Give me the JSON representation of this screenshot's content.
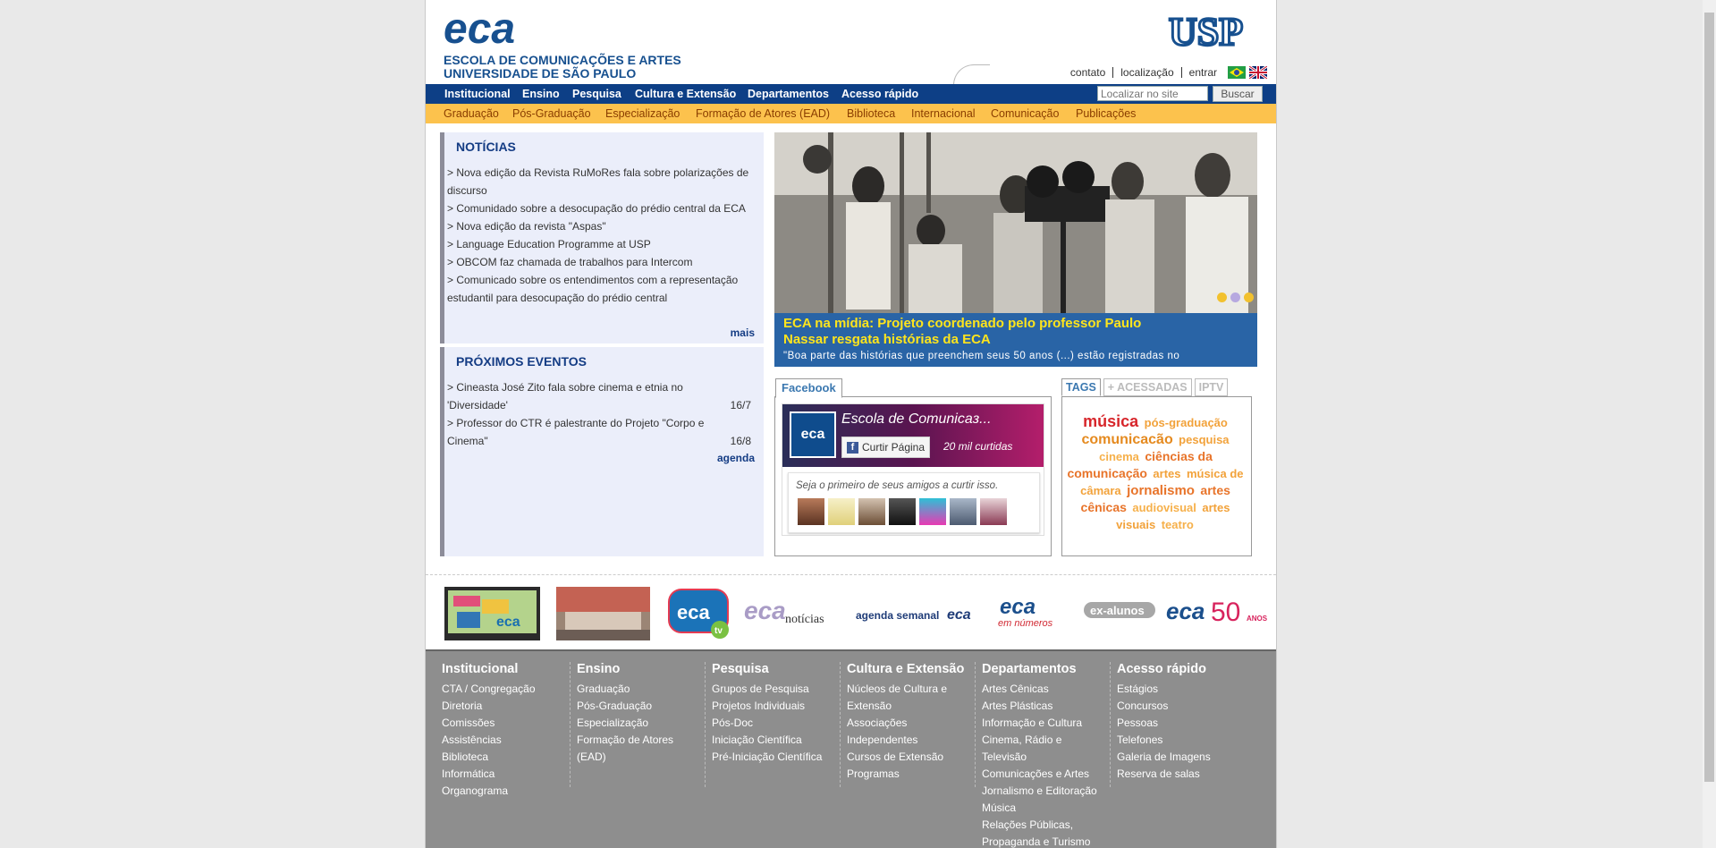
{
  "header": {
    "logo_text": "eca",
    "school_line1": "ESCOLA DE COMUNICAÇÕES E ARTES",
    "school_line2": "UNIVERSIDADE DE SÃO PAULO",
    "usp_logo": "USP",
    "top_links": [
      "contato",
      "localização",
      "entrar"
    ]
  },
  "nav_main": [
    "Institucional",
    "Ensino",
    "Pesquisa",
    "Cultura e Extensão",
    "Departamentos",
    "Acesso rápido"
  ],
  "search": {
    "placeholder": "Localizar no site",
    "button": "Buscar"
  },
  "nav_sub": [
    "Graduação",
    "Pós-Graduação",
    "Especialização",
    "Formação de Atores (EAD)",
    "Biblioteca",
    "Internacional",
    "Comunicação",
    "Publicações"
  ],
  "news": {
    "title": "NOTÍCIAS",
    "items": [
      ">  Nova edição da Revista RuMoRes fala sobre polarizações de discurso",
      ">  Comunidado sobre a desocupação do prédio central da ECA",
      ">  Nova edição da revista \"Aspas\"",
      ">  Language Education Programme at USP",
      ">  OBCOM faz chamada de trabalhos para Intercom",
      ">  Comunicado sobre os entendimentos com a representação estudantil para desocupação do prédio central"
    ],
    "more": "mais"
  },
  "events": {
    "title": "PRÓXIMOS EVENTOS",
    "items": [
      {
        "text": ">  Cineasta José Zito fala sobre cinema e etnia no 'Diversidade'",
        "date": "16/7"
      },
      {
        "text": ">  Professor do CTR é palestrante do Projeto \"Corpo e Cinema\"",
        "date": "16/8"
      }
    ],
    "more": "agenda"
  },
  "slider": {
    "title": "ECA na mídia: Projeto coordenado pelo professor Paulo Nassar resgata histórias da ECA",
    "text": "\"Boa parte das histórias que preenchem seus 50 anos (...) estão registradas no",
    "dot_colors": [
      "#f2c12e",
      "#b7a9e0",
      "#f2c12e"
    ]
  },
  "facebook": {
    "tab": "Facebook",
    "avatar_text": "eca",
    "page_name": "Escola de Comunicaз...",
    "like_button": "Curtir Página",
    "likes": "20 mil curtidas",
    "friends_text": "Seja o primeiro de seus amigos a curtir isso."
  },
  "tabs": [
    "TAGS",
    "+ ACESSADAS",
    "IPTV"
  ],
  "tags": [
    {
      "t": "música",
      "c": "#d7262b",
      "s": 18
    },
    {
      "t": "pós-graduação",
      "c": "#f2a23a",
      "s": 13
    },
    {
      "t": "comunicacão",
      "c": "#e58a1f",
      "s": 16
    },
    {
      "t": "pesquisa",
      "c": "#f2a23a",
      "s": 13
    },
    {
      "t": "cinema",
      "c": "#f6b04a",
      "s": 13
    },
    {
      "t": "ciências da comunicação",
      "c": "#e8742a",
      "s": 14
    },
    {
      "t": "artes",
      "c": "#f2a23a",
      "s": 13
    },
    {
      "t": "música de câmara",
      "c": "#f2a23a",
      "s": 13
    },
    {
      "t": "jornalismo",
      "c": "#e8742a",
      "s": 15
    },
    {
      "t": "artes cênicas",
      "c": "#e8742a",
      "s": 14
    },
    {
      "t": "audiovisual",
      "c": "#f6b04a",
      "s": 13
    },
    {
      "t": "artes visuais",
      "c": "#f2a23a",
      "s": 13
    },
    {
      "t": "teatro",
      "c": "#f6b04a",
      "s": 13
    }
  ],
  "bottom_logos": [
    "eca",
    "eca",
    "notícias",
    "agenda semanal",
    "eca",
    "eca",
    "em números",
    "ex-alunos",
    "eca",
    "50",
    "ANOS"
  ],
  "footer": [
    {
      "title": "Institucional",
      "links": [
        "CTA / Congregação",
        "Diretoria",
        "Comissões",
        "Assistências",
        "Biblioteca",
        "Informática",
        "Organograma"
      ]
    },
    {
      "title": "Ensino",
      "links": [
        "Graduação",
        "Pós-Graduação",
        "Especialização",
        "Formação de Atores",
        "(EAD)"
      ]
    },
    {
      "title": "Pesquisa",
      "links": [
        "Grupos de Pesquisa",
        "Projetos Individuais",
        "Pós-Doc",
        "Iniciação Científica",
        "Pré-Iniciação Científica"
      ]
    },
    {
      "title": "Cultura e Extensão",
      "links": [
        "Núcleos de Cultura e",
        "Extensão",
        "Associações",
        "Independentes",
        "Cursos de Extensão",
        "Programas"
      ]
    },
    {
      "title": "Departamentos",
      "links": [
        "Artes Cênicas",
        "Artes Plásticas",
        "Informação e Cultura",
        "Cinema, Rádio e",
        "Televisão",
        "Comunicações e Artes",
        "Jornalismo e Editoração",
        "Música",
        "Relações Públicas,",
        "Propaganda e Turismo"
      ]
    },
    {
      "title": "Acesso rápido",
      "links": [
        "Estágios",
        "Concursos",
        "Pessoas",
        "Telefones",
        "Galeria de Imagens",
        "Reserva de salas"
      ]
    }
  ]
}
